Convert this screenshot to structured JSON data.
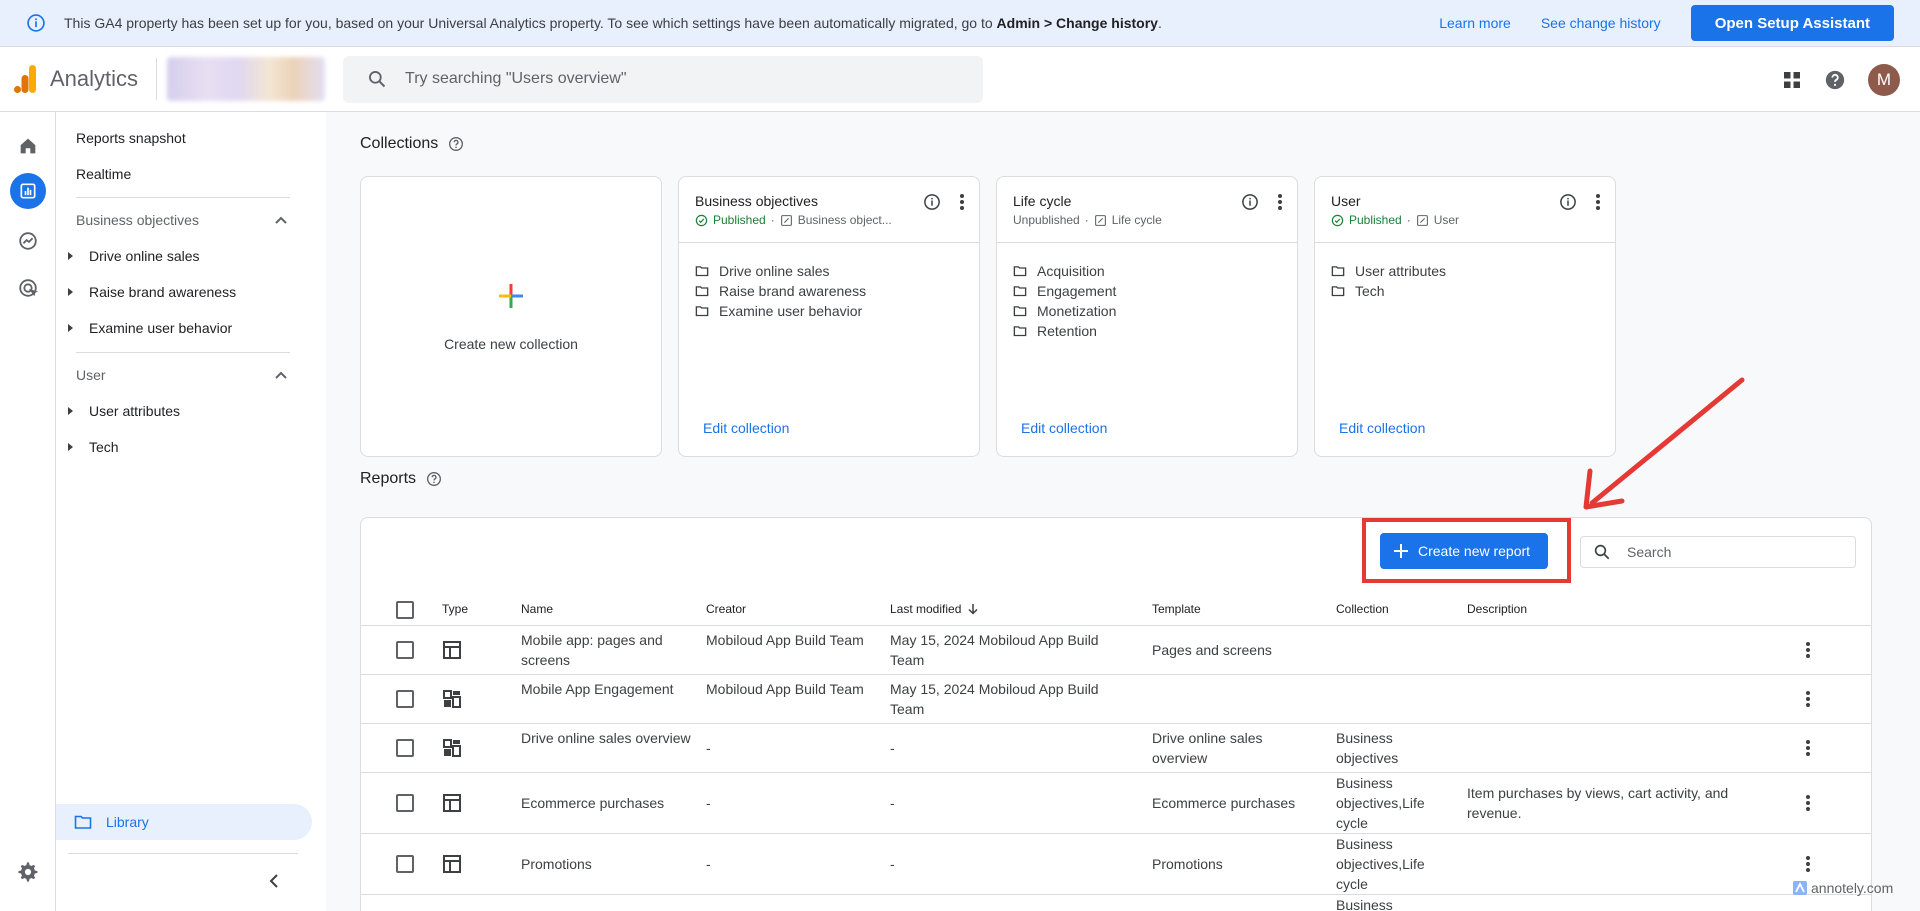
{
  "banner": {
    "message_prefix": "This GA4 property has been set up for you, based on your Universal Analytics property. To see which settings have been automatically migrated, go to ",
    "message_bold": "Admin > Change history",
    "message_suffix": ".",
    "learn_more": "Learn more",
    "see_change_history": "See change history",
    "setup_button": "Open Setup Assistant"
  },
  "topbar": {
    "app_name": "Analytics",
    "search_placeholder": "Try searching \"Users overview\"",
    "avatar_initial": "M"
  },
  "libnav": {
    "reports_snapshot": "Reports snapshot",
    "realtime": "Realtime",
    "sections": [
      {
        "title": "Business objectives",
        "items": [
          "Drive online sales",
          "Raise brand awareness",
          "Examine user behavior"
        ]
      },
      {
        "title": "User",
        "items": [
          "User attributes",
          "Tech"
        ]
      }
    ],
    "library": "Library"
  },
  "collections": {
    "title": "Collections",
    "create_label": "Create new collection",
    "edit_label": "Edit collection",
    "cards": [
      {
        "title": "Business objectives",
        "status": "Published",
        "template": "Business object...",
        "items": [
          "Drive online sales",
          "Raise brand awareness",
          "Examine user behavior"
        ]
      },
      {
        "title": "Life cycle",
        "status": "Unpublished",
        "template": "Life cycle",
        "items": [
          "Acquisition",
          "Engagement",
          "Monetization",
          "Retention"
        ]
      },
      {
        "title": "User",
        "status": "Published",
        "template": "User",
        "items": [
          "User attributes",
          "Tech"
        ]
      }
    ]
  },
  "reports": {
    "title": "Reports",
    "create_button": "Create new report",
    "search_placeholder": "Search",
    "columns": {
      "type": "Type",
      "name": "Name",
      "creator": "Creator",
      "last_modified": "Last modified",
      "template": "Template",
      "collection": "Collection",
      "description": "Description"
    },
    "rows": [
      {
        "type": "detail",
        "name": "Mobile app: pages and screens",
        "creator": "Mobiloud App Build Team",
        "modified": "May 15, 2024 Mobiloud App Build Team",
        "template": "Pages and screens",
        "collection": "",
        "description": ""
      },
      {
        "type": "overview",
        "name": "Mobile App Engagement",
        "creator": "Mobiloud App Build Team",
        "modified": "May 15, 2024 Mobiloud App Build Team",
        "template": "",
        "collection": "",
        "description": ""
      },
      {
        "type": "overview",
        "name": "Drive online sales overview",
        "creator": "-",
        "modified": "-",
        "template": "Drive online sales overview",
        "collection": "Business objectives",
        "description": ""
      },
      {
        "type": "detail",
        "name": "Ecommerce purchases",
        "creator": "-",
        "modified": "-",
        "template": "Ecommerce purchases",
        "collection": "Business objectives,Life cycle",
        "description": "Item purchases by views, cart activity, and revenue."
      },
      {
        "type": "detail",
        "name": "Promotions",
        "creator": "-",
        "modified": "-",
        "template": "Promotions",
        "collection": "Business objectives,Life cycle",
        "description": ""
      },
      {
        "type": "detail",
        "name": "",
        "creator": "",
        "modified": "",
        "template": "",
        "collection": "Business",
        "description": ""
      }
    ]
  },
  "watermark": "annotely.com",
  "colors": {
    "accent": "#1a73e8",
    "banner_bg": "#e8f0fe",
    "annotation": "#e53935",
    "published": "#188038"
  }
}
